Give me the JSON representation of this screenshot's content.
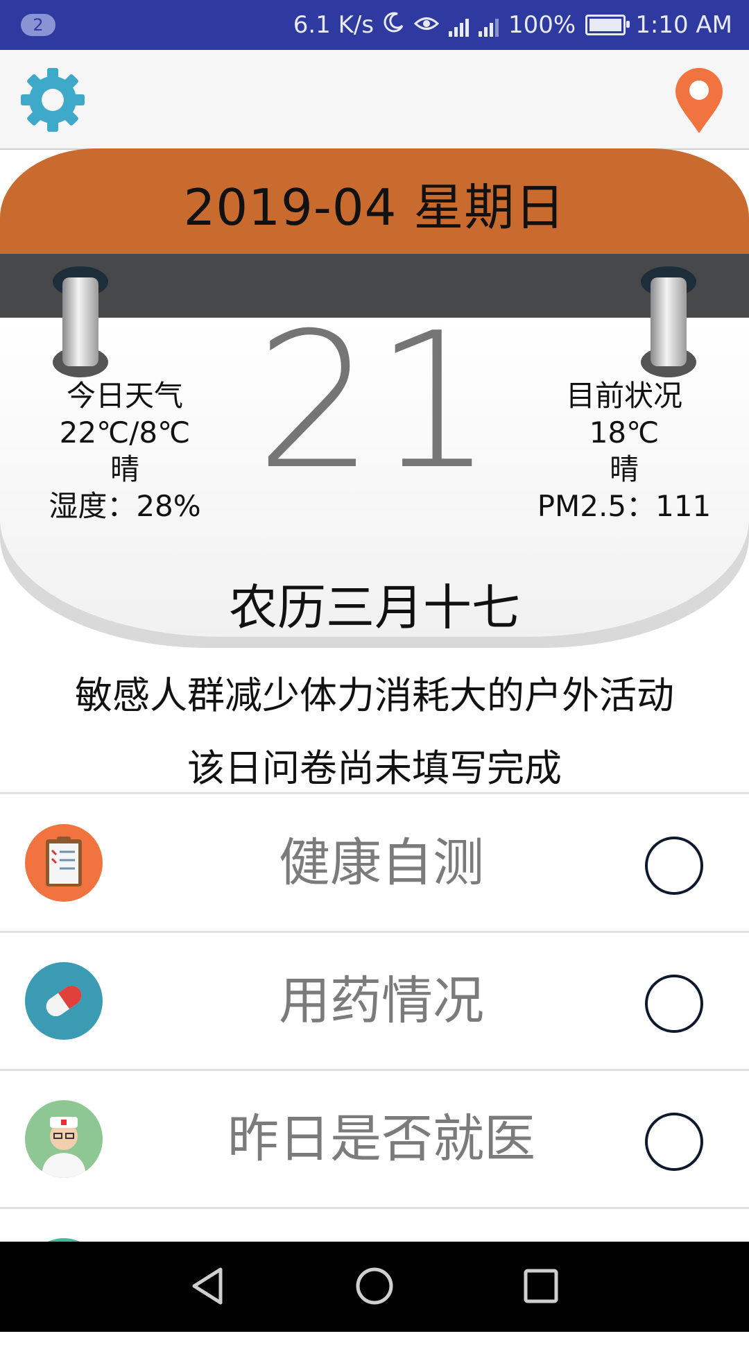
{
  "status_bar": {
    "notification_count": "2",
    "network_speed": "6.1 K/s",
    "battery": "100%",
    "time": "1:10 AM",
    "icons": [
      "moon-icon",
      "eye-icon",
      "signal-2g-icon",
      "signal-4g-icon",
      "battery-icon"
    ]
  },
  "toolbar": {
    "settings_icon": "gear-icon",
    "location_icon": "location-pin-icon"
  },
  "calendar": {
    "month_weekday": "2019-04 星期日",
    "day": "21",
    "lunar_date": "农历三月十七",
    "today_weather": {
      "title": "今日天气",
      "temp_range": "22℃/8℃",
      "condition": "晴",
      "humidity": "湿度：28%"
    },
    "current_status": {
      "title": "目前状况",
      "temp": "18℃",
      "condition": "晴",
      "pm25": "PM2.5：111"
    },
    "colors": {
      "header": "#c96a2f",
      "band": "#47484a",
      "day": "#757575"
    }
  },
  "advice": "敏感人群减少体力消耗大的户外活动",
  "survey_status": "该日问卷尚未填写完成",
  "tasks": [
    {
      "label": "健康自测",
      "icon": "clipboard-icon",
      "icon_bg": "#f07340",
      "checked": false
    },
    {
      "label": "用药情况",
      "icon": "pill-icon",
      "icon_bg": "#3a9bb3",
      "checked": false
    },
    {
      "label": "昨日是否就医",
      "icon": "doctor-icon",
      "icon_bg": "#8fc794",
      "checked": false
    },
    {
      "label": "",
      "icon": "partial-icon",
      "icon_bg": "#3fb99a",
      "checked": false
    }
  ],
  "nav": {
    "back_icon": "back-triangle-icon",
    "home_icon": "home-circle-icon",
    "recent_icon": "recent-square-icon"
  }
}
